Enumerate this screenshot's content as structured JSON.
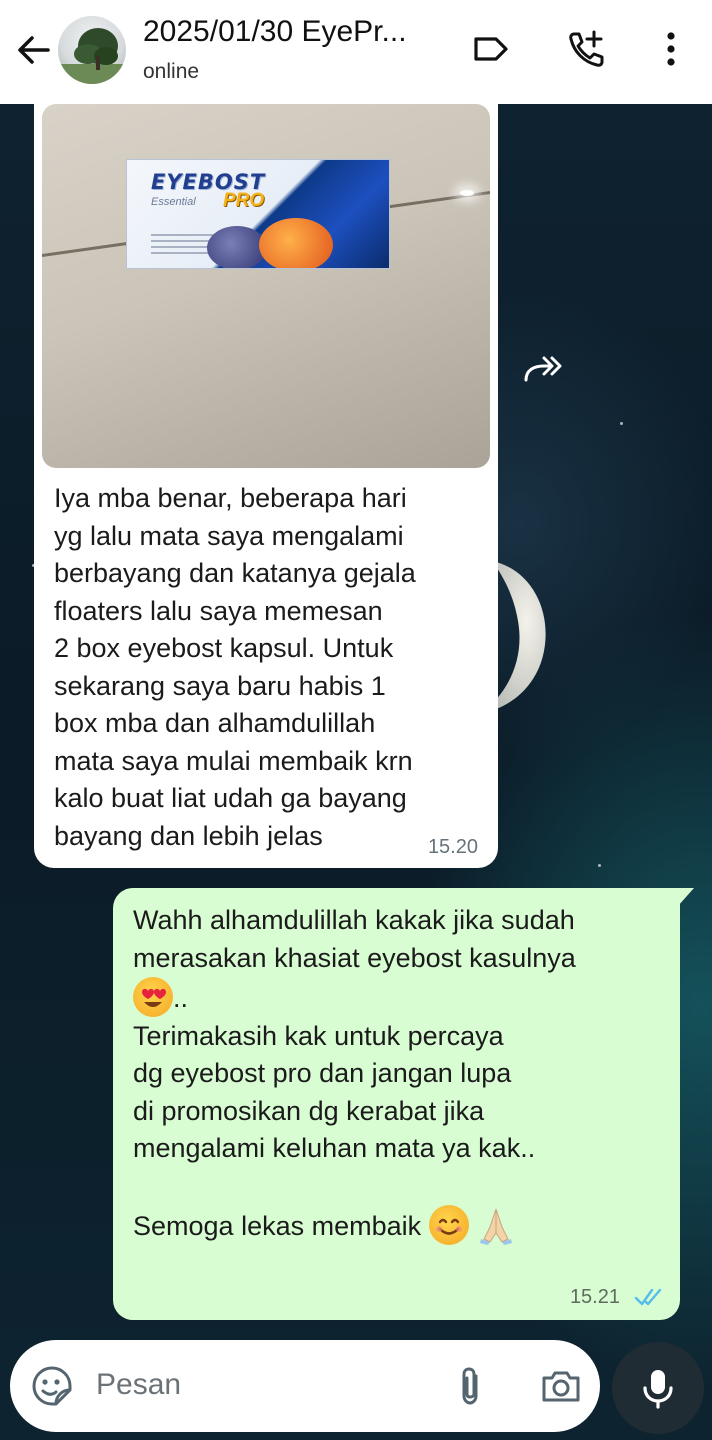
{
  "header": {
    "back_icon": "arrow-back-icon",
    "contact_name": "2025/01/30 EyePr...",
    "status": "online",
    "icons": [
      "label-icon",
      "add-call-icon",
      "more-vert-icon"
    ]
  },
  "messages": [
    {
      "direction": "incoming",
      "has_image": true,
      "image_product_text": {
        "brand": "EYEBOST",
        "line": "Essential",
        "variant": "PRO"
      },
      "text": "Iya mba benar, beberapa hari\nyg lalu mata saya mengalami\nberbayang dan katanya gejala\nfloaters lalu saya memesan\n2 box eyebost kapsul. Untuk\nsekarang saya baru habis 1\nbox mba dan alhamdulillah\nmata saya mulai membaik krn\nkalo buat liat udah ga bayang\nbayang dan lebih jelas",
      "time": "15.20"
    },
    {
      "direction": "outgoing",
      "lines": {
        "l1": "Wahh alhamdulillah kakak jika sudah",
        "l2": "merasakan khasiat eyebost kasulnya",
        "l3_suffix": "..",
        "l4": "Terimakasih kak untuk percaya",
        "l5": "dg eyebost pro dan jangan lupa",
        "l6": "di promosikan dg kerabat jika",
        "l7": "mengalami keluhan mata ya kak..",
        "l8": "Semoga lekas membaik"
      },
      "emojis": [
        "heart-eyes-emoji",
        "smiling-face-emoji",
        "folded-hands-emoji"
      ],
      "time": "15.21",
      "read_status": "read"
    }
  ],
  "composer": {
    "placeholder": "Pesan",
    "icons": [
      "sticker-icon",
      "attach-icon",
      "camera-icon",
      "mic-icon"
    ]
  },
  "colors": {
    "outgoing_bubble": "#d9fdd3",
    "incoming_bubble": "#ffffff",
    "read_ticks": "#53bdeb",
    "mic_button": "#1f2c33"
  }
}
